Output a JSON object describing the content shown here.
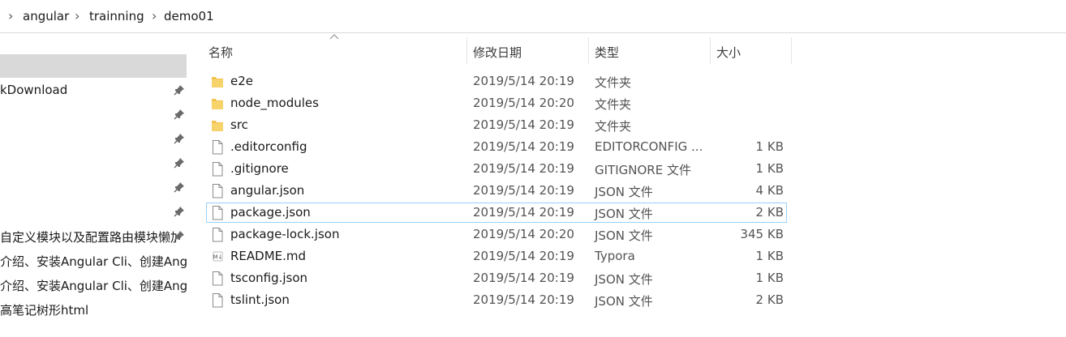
{
  "breadcrumb": [
    "angular",
    "trainning",
    "demo01"
  ],
  "nav": {
    "items": [
      {
        "label": ""
      },
      {
        "label": "kDownload"
      },
      {
        "label": ""
      },
      {
        "label": ""
      },
      {
        "label": ""
      },
      {
        "label": ""
      },
      {
        "label": ""
      },
      {
        "label": "自定义模块以及配置路由模块懒加"
      },
      {
        "label": "介绍、安装Angular Cli、创建Angula"
      },
      {
        "label": "介绍、安装Angular Cli、创建Angula"
      },
      {
        "label": "高笔记树形html"
      }
    ]
  },
  "columns": {
    "name": "名称",
    "date": "修改日期",
    "type": "类型",
    "size": "大小"
  },
  "files": [
    {
      "name": "e2e",
      "date": "2019/5/14 20:19",
      "type": "文件夹",
      "size": "",
      "icon": "folder-icon"
    },
    {
      "name": "node_modules",
      "date": "2019/5/14 20:20",
      "type": "文件夹",
      "size": "",
      "icon": "folder-icon"
    },
    {
      "name": "src",
      "date": "2019/5/14 20:19",
      "type": "文件夹",
      "size": "",
      "icon": "folder-icon"
    },
    {
      "name": ".editorconfig",
      "date": "2019/5/14 20:19",
      "type": "EDITORCONFIG ...",
      "size": "1 KB",
      "icon": "file-icon"
    },
    {
      "name": ".gitignore",
      "date": "2019/5/14 20:19",
      "type": "GITIGNORE 文件",
      "size": "1 KB",
      "icon": "file-icon"
    },
    {
      "name": "angular.json",
      "date": "2019/5/14 20:19",
      "type": "JSON 文件",
      "size": "4 KB",
      "icon": "file-icon"
    },
    {
      "name": "package.json",
      "date": "2019/5/14 20:19",
      "type": "JSON 文件",
      "size": "2 KB",
      "icon": "file-icon"
    },
    {
      "name": "package-lock.json",
      "date": "2019/5/14 20:20",
      "type": "JSON 文件",
      "size": "345 KB",
      "icon": "file-icon"
    },
    {
      "name": "README.md",
      "date": "2019/5/14 20:19",
      "type": "Typora",
      "size": "1 KB",
      "icon": "markdown-file-icon"
    },
    {
      "name": "tsconfig.json",
      "date": "2019/5/14 20:19",
      "type": "JSON 文件",
      "size": "1 KB",
      "icon": "file-icon"
    },
    {
      "name": "tslint.json",
      "date": "2019/5/14 20:19",
      "type": "JSON 文件",
      "size": "2 KB",
      "icon": "file-icon"
    }
  ],
  "colors": {
    "folder": "#f2c14e",
    "selection_border": "#99d1ff",
    "nav_selected": "#d9d9d9"
  }
}
